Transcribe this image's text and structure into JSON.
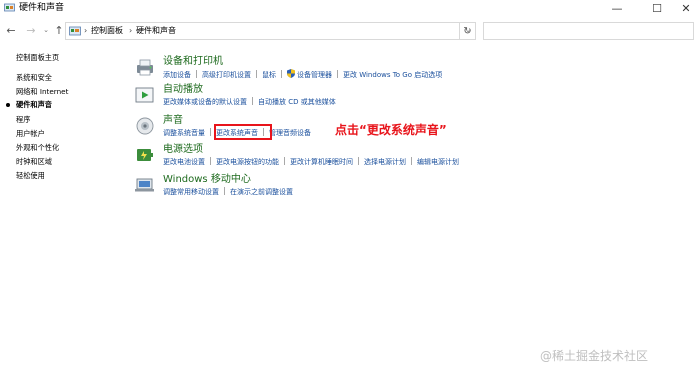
{
  "window": {
    "title": "硬件和声音",
    "controls": {
      "minimize": "—",
      "maximize": "☐",
      "close": "✕"
    }
  },
  "nav": {
    "back": "←",
    "forward": "→",
    "recent": "⌄",
    "up": "↑",
    "refresh": "↻",
    "breadcrumb": [
      "控制面板",
      "硬件和声音"
    ],
    "separator": "›",
    "dropdown": "⌄",
    "search_placeholder": ""
  },
  "sidebar": {
    "items": [
      {
        "label": "控制面板主页",
        "current": false
      },
      {
        "label": "系统和安全",
        "current": false
      },
      {
        "label": "网络和 Internet",
        "current": false
      },
      {
        "label": "硬件和声音",
        "current": true
      },
      {
        "label": "程序",
        "current": false
      },
      {
        "label": "用户帐户",
        "current": false
      },
      {
        "label": "外观和个性化",
        "current": false
      },
      {
        "label": "时钟和区域",
        "current": false
      },
      {
        "label": "轻松使用",
        "current": false
      }
    ]
  },
  "categories": [
    {
      "title": "设备和打印机",
      "icon": "printer-icon",
      "links": [
        "添加设备",
        "高级打印机设置",
        "鼠标",
        "设备管理器",
        "更改 Windows To Go 启动选项"
      ]
    },
    {
      "title": "自动播放",
      "icon": "autoplay-icon",
      "links": [
        "更改媒体或设备的默认设置",
        "自动播放 CD 或其他媒体"
      ]
    },
    {
      "title": "声音",
      "icon": "speaker-icon",
      "links": [
        "调整系统音量",
        "更改系统声音",
        "管理音频设备"
      ]
    },
    {
      "title": "电源选项",
      "icon": "power-icon",
      "links": [
        "更改电池设置",
        "更改电源按钮的功能",
        "更改计算机睡眠时间",
        "选择电源计划",
        "编辑电源计划"
      ]
    },
    {
      "title": "Windows 移动中心",
      "icon": "mobility-center-icon",
      "links": [
        "调整常用移动设置",
        "在演示之前调整设置"
      ]
    }
  ],
  "annotation": "点击“更改系统声音”",
  "watermark": "@稀土掘金技术社区",
  "colors": {
    "category_title": "#1e6a1e",
    "link": "#1a4f9c",
    "annotation": "#e8141b"
  }
}
